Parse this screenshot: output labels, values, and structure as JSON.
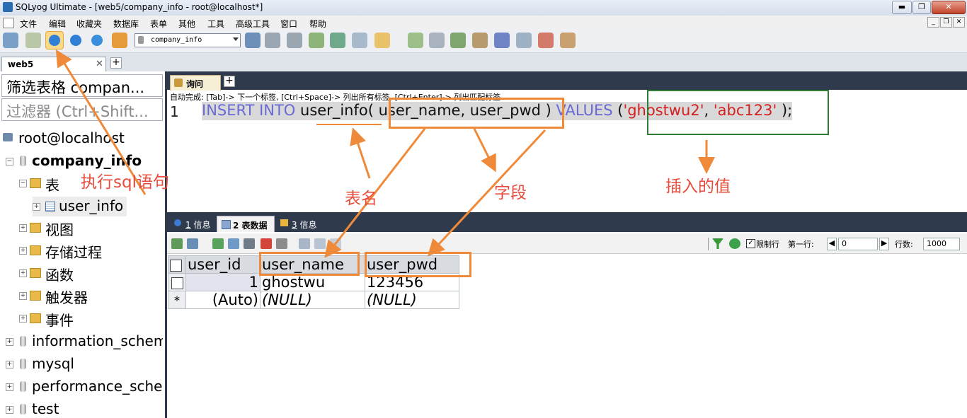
{
  "window": {
    "title": "SQLyog Ultimate - [web5/company_info - root@localhost*]",
    "minimize": "▬",
    "maximize": "❐",
    "close": "✕"
  },
  "menu": [
    "文件",
    "编辑",
    "收藏夹",
    "数据库",
    "表单",
    "其他",
    "工具",
    "高级工具",
    "窗口",
    "帮助"
  ],
  "mdi_controls": [
    "_",
    "❐",
    "✕"
  ],
  "toolbar": {
    "database_select": "company_info"
  },
  "connection_tab": {
    "label": "web5",
    "close": "✕",
    "add": "+"
  },
  "left_panel": {
    "filter_label": "筛选表格 compan...",
    "filter_placeholder": "过滤器 (Ctrl+Shift...",
    "root": "root@localhost",
    "db_company": "company_info",
    "folder_tables": "表",
    "table_user_info": "user_info",
    "folder_views": "视图",
    "folder_procs": "存储过程",
    "folder_funcs": "函数",
    "folder_triggers": "触发器",
    "folder_events": "事件",
    "db_info_schema": "information_schem",
    "db_mysql": "mysql",
    "db_perf": "performance_scher",
    "db_test": "test"
  },
  "query": {
    "tab_label": "询问",
    "add": "+",
    "autocomplete_hint": "自动完成:  [Tab]-> 下一个标签,  [Ctrl+Space]-> 列出所有标签,  [Ctrl+Enter]-> 列出匹配标签",
    "line_number": "1",
    "sql": {
      "kw_insert": "INSERT INTO",
      "table": "user_info(",
      "fields": "user_name, user_pwd",
      "close_paren": ")",
      "kw_values": "VALUES",
      "open_paren": "(",
      "val1": "'ghostwu2'",
      "comma": ",",
      "val2": "'abc123'",
      "end": ");"
    }
  },
  "result_tabs": [
    {
      "num": "1",
      "label": "信息"
    },
    {
      "num": "2",
      "label": "表数据"
    },
    {
      "num": "3",
      "label": "信息"
    }
  ],
  "grid_toolbar": {
    "limit_label": "限制行",
    "first_row_label": "第一行:",
    "first_row_value": "0",
    "rows_label": "行数:",
    "rows_value": "1000"
  },
  "grid": {
    "columns": [
      "user_id",
      "user_name",
      "user_pwd"
    ],
    "rows": [
      {
        "marker": "",
        "user_id": "1",
        "user_name": "ghostwu",
        "user_pwd": "123456"
      },
      {
        "marker": "*",
        "user_id": "(Auto)",
        "user_name": "(NULL)",
        "user_pwd": "(NULL)"
      }
    ]
  },
  "annotations": {
    "execute_sql": "执行sql语句",
    "table_name": "表名",
    "fields": "字段",
    "values": "插入的值"
  },
  "colors": {
    "annotation_orange": "#ef8a3a",
    "annotation_red": "#e74c3c",
    "annotation_green": "#2e7d32",
    "sql_keyword": "#6a6ad4",
    "sql_string": "#d42020",
    "dark_tab_bg": "#2f3b4d"
  }
}
